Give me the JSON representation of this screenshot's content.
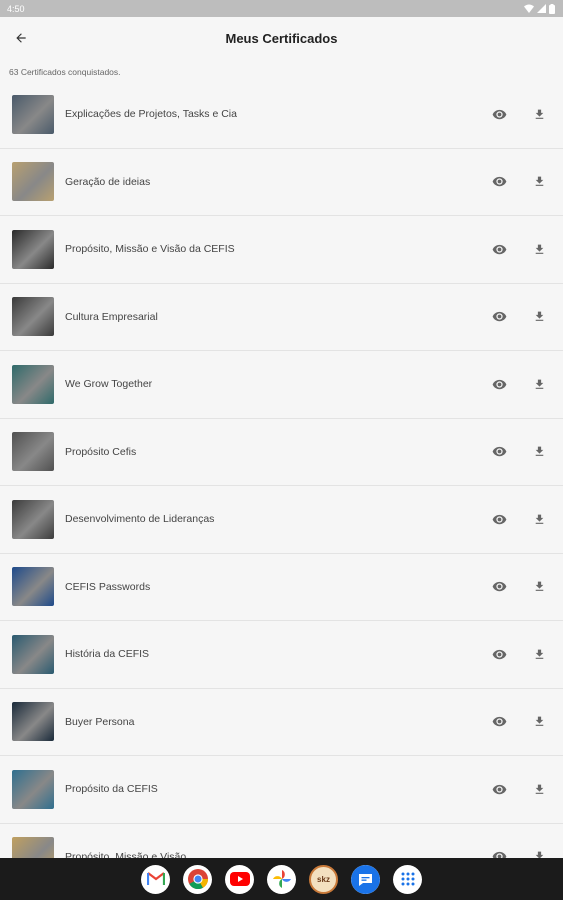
{
  "status_bar": {
    "time": "4:50"
  },
  "header": {
    "title": "Meus Certificados"
  },
  "summary": {
    "count_text": "63 Certificados conquistados."
  },
  "certificates": [
    {
      "title": "Explicações de Projetos, Tasks e Cia",
      "thumb_color": "#4a5a6a"
    },
    {
      "title": "Geração de ideias",
      "thumb_color": "#b8a070"
    },
    {
      "title": "Propósito, Missão e Visão da CEFIS",
      "thumb_color": "#2a2a2a"
    },
    {
      "title": "Cultura Empresarial",
      "thumb_color": "#3a3a3a"
    },
    {
      "title": "We Grow Together",
      "thumb_color": "#2f6a6a"
    },
    {
      "title": "Propósito Cefis",
      "thumb_color": "#505050"
    },
    {
      "title": "Desenvolvimento de Lideranças",
      "thumb_color": "#3c3c3c"
    },
    {
      "title": "CEFIS Passwords",
      "thumb_color": "#1e4a8a"
    },
    {
      "title": "História da CEFIS",
      "thumb_color": "#2a5a70"
    },
    {
      "title": "Buyer Persona",
      "thumb_color": "#1a2a3a"
    },
    {
      "title": "Propósito da CEFIS",
      "thumb_color": "#2f6f8f"
    },
    {
      "title": "Propósito, Missão e Visão",
      "thumb_color": "#c0a060"
    }
  ],
  "taskbar_apps": [
    {
      "name": "gmail-icon"
    },
    {
      "name": "chrome-icon"
    },
    {
      "name": "youtube-icon"
    },
    {
      "name": "photos-icon"
    },
    {
      "name": "skz-app-icon",
      "label": "skz"
    },
    {
      "name": "messages-icon"
    },
    {
      "name": "app-drawer-icon"
    }
  ]
}
